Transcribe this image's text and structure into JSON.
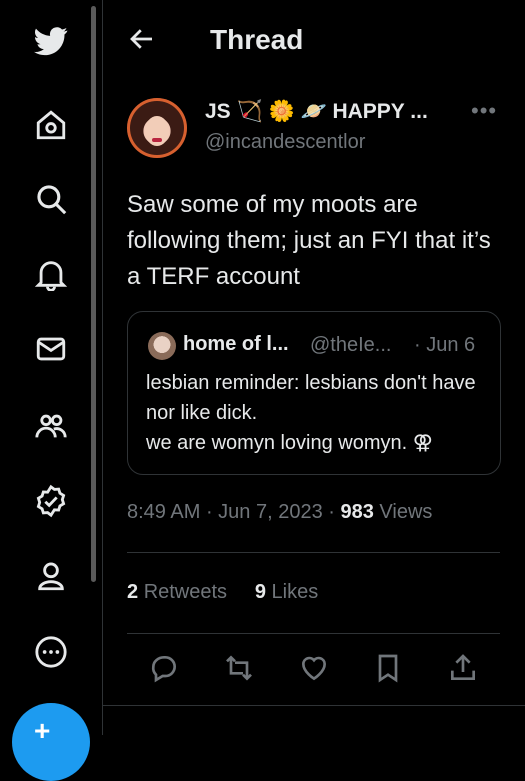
{
  "header": {
    "title": "Thread"
  },
  "tweet": {
    "display_name": "JS 🏹 🌼 🪐 HAPPY ...",
    "handle": "@incandescentlor",
    "text": "Saw some of my moots are following them; just an FYI that it’s a TERF account",
    "time": "8:49 AM",
    "date": "Jun 7, 2023",
    "views_count": "983",
    "views_label": "Views",
    "retweets_count": "2",
    "retweets_label": "Retweets",
    "likes_count": "9",
    "likes_label": "Likes"
  },
  "quoted": {
    "display_name": "home of l...",
    "handle": "@theIe...",
    "date": "· Jun 6",
    "text_line1": "lesbian reminder: lesbians don't have nor like dick.",
    "text_line2": "we are womyn loving womyn. ⚢"
  },
  "nav_icons": [
    "twitter-logo-icon",
    "home-icon",
    "search-icon",
    "notifications-icon",
    "messages-icon",
    "communities-icon",
    "verified-icon",
    "profile-icon",
    "more-icon",
    "compose-icon"
  ],
  "colors": {
    "background": "#000000",
    "text": "#e7e9ea",
    "secondary": "#71767b",
    "accent": "#1d9bf0",
    "border": "#2f3336"
  }
}
